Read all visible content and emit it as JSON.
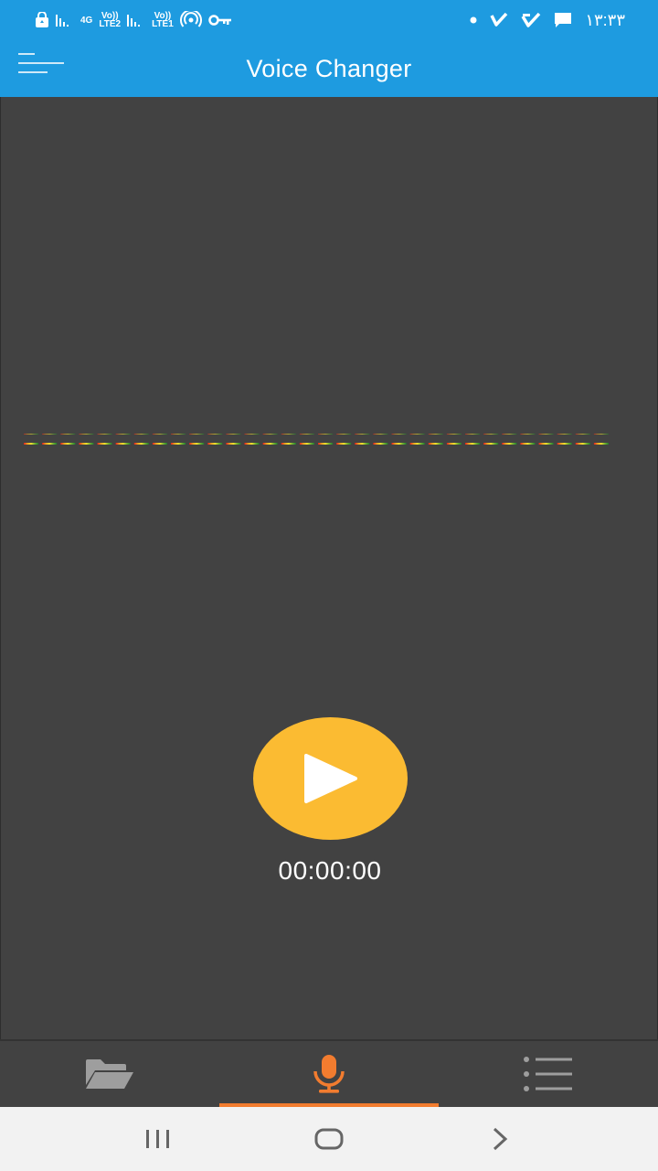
{
  "status_bar": {
    "network_type": "4G",
    "volte_sim2": "Vo))",
    "lte_sim2": "LTE2",
    "volte_sim1": "Vo))",
    "lte_sim1": "LTE1",
    "time": "۱۳:۳۳"
  },
  "app_bar": {
    "title": "Voice Changer"
  },
  "player": {
    "timer": "00:00:00",
    "level_meter": {
      "segments": 32,
      "colors": [
        "#e02020",
        "#e8a020",
        "#f0e030",
        "#70b030",
        "#207a30"
      ]
    }
  },
  "bottom_nav": {
    "tabs": [
      {
        "name": "folder",
        "icon": "folder-open-icon",
        "active": false
      },
      {
        "name": "record",
        "icon": "microphone-icon",
        "active": true
      },
      {
        "name": "list",
        "icon": "list-icon",
        "active": false
      }
    ],
    "accent_color": "#f27c2f"
  },
  "system_nav": {
    "buttons": [
      "recent-apps-icon",
      "home-icon",
      "back-icon"
    ]
  },
  "colors": {
    "primary": "#1e9be0",
    "background": "#424242",
    "play_button": "#fbbb32"
  }
}
